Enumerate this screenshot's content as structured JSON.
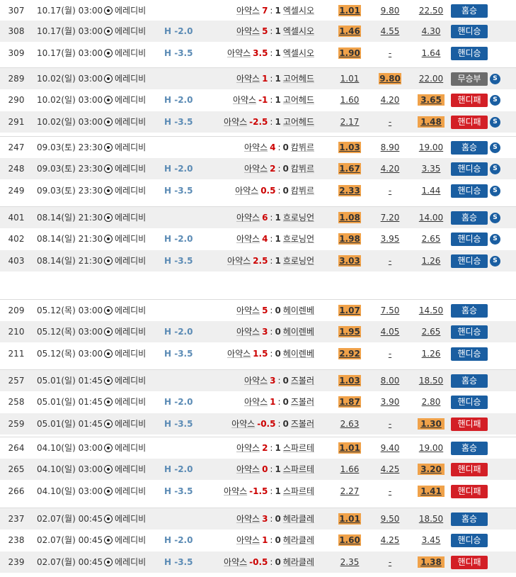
{
  "rows": [
    {
      "no": "307",
      "date": "10.17(월) 03:00",
      "league": "에레디비",
      "hc": "",
      "home": "아약스",
      "score": "7",
      "sep": ":",
      "away_score": "1",
      "away": "엑셀시오",
      "o1": "1.01",
      "o2": "9.80",
      "o3": "22.50",
      "hit": 1,
      "result": "홈승",
      "color": "blue",
      "s": false
    },
    {
      "no": "308",
      "date": "10.17(월) 03:00",
      "league": "에레디비",
      "hc": "H -2.0",
      "home": "아약스",
      "score": "5",
      "sep": ":",
      "away_score": "1",
      "away": "엑셀시오",
      "o1": "1.46",
      "o2": "4.55",
      "o3": "4.30",
      "hit": 1,
      "result": "핸디승",
      "color": "blue",
      "s": false
    },
    {
      "no": "309",
      "date": "10.17(월) 03:00",
      "league": "에레디비",
      "hc": "H -3.5",
      "home": "아약스",
      "score": "3.5",
      "sep": ":",
      "away_score": "1",
      "away": "엑셀시오",
      "o1": "1.90",
      "o2": "-",
      "o3": "1.64",
      "hit": 1,
      "result": "핸디승",
      "color": "blue",
      "s": false
    },
    {
      "no": "289",
      "date": "10.02(일) 03:00",
      "league": "에레디비",
      "hc": "",
      "home": "아약스",
      "score": "1",
      "sep": ":",
      "away_score": "1",
      "away": "고어헤드",
      "o1": "1.01",
      "o2": "9.80",
      "o3": "22.00",
      "hit": 2,
      "result": "무승부",
      "color": "gray",
      "s": true
    },
    {
      "no": "290",
      "date": "10.02(일) 03:00",
      "league": "에레디비",
      "hc": "H -2.0",
      "home": "아약스",
      "score": "-1",
      "sep": ":",
      "away_score": "1",
      "away": "고어헤드",
      "o1": "1.60",
      "o2": "4.20",
      "o3": "3.65",
      "hit": 3,
      "result": "핸디패",
      "color": "red",
      "s": true
    },
    {
      "no": "291",
      "date": "10.02(일) 03:00",
      "league": "에레디비",
      "hc": "H -3.5",
      "home": "아약스",
      "score": "-2.5",
      "sep": ":",
      "away_score": "1",
      "away": "고어헤드",
      "o1": "2.17",
      "o2": "-",
      "o3": "1.48",
      "hit": 3,
      "result": "핸디패",
      "color": "red",
      "s": true
    },
    {
      "no": "247",
      "date": "09.03(토) 23:30",
      "league": "에레디비",
      "hc": "",
      "home": "아약스",
      "score": "4",
      "sep": ":",
      "away_score": "0",
      "away": "캄뷔르",
      "o1": "1.03",
      "o2": "8.90",
      "o3": "19.00",
      "hit": 1,
      "result": "홈승",
      "color": "blue",
      "s": true
    },
    {
      "no": "248",
      "date": "09.03(토) 23:30",
      "league": "에레디비",
      "hc": "H -2.0",
      "home": "아약스",
      "score": "2",
      "sep": ":",
      "away_score": "0",
      "away": "캄뷔르",
      "o1": "1.67",
      "o2": "4.20",
      "o3": "3.35",
      "hit": 1,
      "result": "핸디승",
      "color": "blue",
      "s": true
    },
    {
      "no": "249",
      "date": "09.03(토) 23:30",
      "league": "에레디비",
      "hc": "H -3.5",
      "home": "아약스",
      "score": "0.5",
      "sep": ":",
      "away_score": "0",
      "away": "캄뷔르",
      "o1": "2.33",
      "o2": "-",
      "o3": "1.44",
      "hit": 1,
      "result": "핸디승",
      "color": "blue",
      "s": true
    },
    {
      "no": "401",
      "date": "08.14(일) 21:30",
      "league": "에레디비",
      "hc": "",
      "home": "아약스",
      "score": "6",
      "sep": ":",
      "away_score": "1",
      "away": "흐로닝언",
      "o1": "1.08",
      "o2": "7.20",
      "o3": "14.00",
      "hit": 1,
      "result": "홈승",
      "color": "blue",
      "s": true
    },
    {
      "no": "402",
      "date": "08.14(일) 21:30",
      "league": "에레디비",
      "hc": "H -2.0",
      "home": "아약스",
      "score": "4",
      "sep": ":",
      "away_score": "1",
      "away": "흐로닝언",
      "o1": "1.98",
      "o2": "3.95",
      "o3": "2.65",
      "hit": 1,
      "result": "핸디승",
      "color": "blue",
      "s": true
    },
    {
      "no": "403",
      "date": "08.14(일) 21:30",
      "league": "에레디비",
      "hc": "H -3.5",
      "home": "아약스",
      "score": "2.5",
      "sep": ":",
      "away_score": "1",
      "away": "흐로닝언",
      "o1": "3.03",
      "o2": "-",
      "o3": "1.26",
      "hit": 1,
      "result": "핸디승",
      "color": "blue",
      "s": true
    },
    {
      "no": "209",
      "date": "05.12(목) 03:00",
      "league": "에레디비",
      "hc": "",
      "home": "아약스",
      "score": "5",
      "sep": ":",
      "away_score": "0",
      "away": "헤이렌베",
      "o1": "1.07",
      "o2": "7.50",
      "o3": "14.50",
      "hit": 1,
      "result": "홈승",
      "color": "blue",
      "s": false
    },
    {
      "no": "210",
      "date": "05.12(목) 03:00",
      "league": "에레디비",
      "hc": "H -2.0",
      "home": "아약스",
      "score": "3",
      "sep": ":",
      "away_score": "0",
      "away": "헤이렌베",
      "o1": "1.95",
      "o2": "4.05",
      "o3": "2.65",
      "hit": 1,
      "result": "핸디승",
      "color": "blue",
      "s": false
    },
    {
      "no": "211",
      "date": "05.12(목) 03:00",
      "league": "에레디비",
      "hc": "H -3.5",
      "home": "아약스",
      "score": "1.5",
      "sep": ":",
      "away_score": "0",
      "away": "헤이렌베",
      "o1": "2.92",
      "o2": "-",
      "o3": "1.26",
      "hit": 1,
      "result": "핸디승",
      "color": "blue",
      "s": false
    },
    {
      "no": "257",
      "date": "05.01(일) 01:45",
      "league": "에레디비",
      "hc": "",
      "home": "아약스",
      "score": "3",
      "sep": ":",
      "away_score": "0",
      "away": "즈볼러",
      "o1": "1.03",
      "o2": "8.00",
      "o3": "18.50",
      "hit": 1,
      "result": "홈승",
      "color": "blue",
      "s": false
    },
    {
      "no": "258",
      "date": "05.01(일) 01:45",
      "league": "에레디비",
      "hc": "H -2.0",
      "home": "아약스",
      "score": "1",
      "sep": ":",
      "away_score": "0",
      "away": "즈볼러",
      "o1": "1.87",
      "o2": "3.90",
      "o3": "2.80",
      "hit": 1,
      "result": "핸디승",
      "color": "blue",
      "s": false
    },
    {
      "no": "259",
      "date": "05.01(일) 01:45",
      "league": "에레디비",
      "hc": "H -3.5",
      "home": "아약스",
      "score": "-0.5",
      "sep": ":",
      "away_score": "0",
      "away": "즈볼러",
      "o1": "2.63",
      "o2": "-",
      "o3": "1.30",
      "hit": 3,
      "result": "핸디패",
      "color": "red",
      "s": false
    },
    {
      "no": "264",
      "date": "04.10(일) 03:00",
      "league": "에레디비",
      "hc": "",
      "home": "아약스",
      "score": "2",
      "sep": ":",
      "away_score": "1",
      "away": "스파르테",
      "o1": "1.01",
      "o2": "9.40",
      "o3": "19.00",
      "hit": 1,
      "result": "홈승",
      "color": "blue",
      "s": false
    },
    {
      "no": "265",
      "date": "04.10(일) 03:00",
      "league": "에레디비",
      "hc": "H -2.0",
      "home": "아약스",
      "score": "0",
      "sep": ":",
      "away_score": "1",
      "away": "스파르테",
      "o1": "1.66",
      "o2": "4.25",
      "o3": "3.20",
      "hit": 3,
      "result": "핸디패",
      "color": "red",
      "s": false
    },
    {
      "no": "266",
      "date": "04.10(일) 03:00",
      "league": "에레디비",
      "hc": "H -3.5",
      "home": "아약스",
      "score": "-1.5",
      "sep": ":",
      "away_score": "1",
      "away": "스파르테",
      "o1": "2.27",
      "o2": "-",
      "o3": "1.41",
      "hit": 3,
      "result": "핸디패",
      "color": "red",
      "s": false
    },
    {
      "no": "237",
      "date": "02.07(월) 00:45",
      "league": "에레디비",
      "hc": "",
      "home": "아약스",
      "score": "3",
      "sep": ":",
      "away_score": "0",
      "away": "헤라클레",
      "o1": "1.01",
      "o2": "9.50",
      "o3": "18.50",
      "hit": 1,
      "result": "홈승",
      "color": "blue",
      "s": false
    },
    {
      "no": "238",
      "date": "02.07(월) 00:45",
      "league": "에레디비",
      "hc": "H -2.0",
      "home": "아약스",
      "score": "1",
      "sep": ":",
      "away_score": "0",
      "away": "헤라클레",
      "o1": "1.60",
      "o2": "4.25",
      "o3": "3.45",
      "hit": 1,
      "result": "핸디승",
      "color": "blue",
      "s": false
    },
    {
      "no": "239",
      "date": "02.07(월) 00:45",
      "league": "에레디비",
      "hc": "H -3.5",
      "home": "아약스",
      "score": "-0.5",
      "sep": ":",
      "away_score": "0",
      "away": "헤라클레",
      "o1": "2.35",
      "o2": "-",
      "o3": "1.38",
      "hit": 3,
      "result": "핸디패",
      "color": "red",
      "s": false
    }
  ],
  "s_icon_label": "S",
  "colors": {
    "blue": "#1a5ea1",
    "red": "#d31f26",
    "gray": "#6c6c6c",
    "hit": "#f0a24a",
    "handicap": "#5b8bb5"
  }
}
